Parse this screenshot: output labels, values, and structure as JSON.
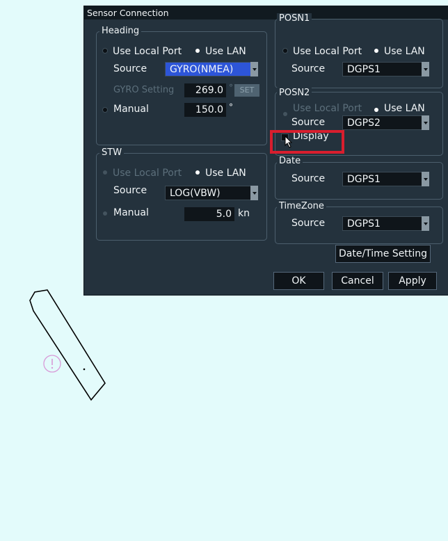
{
  "dialog": {
    "title": "Sensor Connection",
    "heading": {
      "title": "Heading",
      "use_local_port": "Use Local Port",
      "use_lan": "Use LAN",
      "source_label": "Source",
      "source_value": "GYRO(NMEA)",
      "gyro_setting_label": "GYRO Setting",
      "gyro_value": "269.0",
      "gyro_unit": "°",
      "set_label": "SET",
      "manual_label": "Manual",
      "manual_value": "150.0",
      "manual_unit": "°"
    },
    "stw": {
      "title": "STW",
      "use_local_port": "Use Local Port",
      "use_lan": "Use LAN",
      "source_label": "Source",
      "source_value": "LOG(VBW)",
      "manual_label": "Manual",
      "manual_value": "5.0",
      "manual_unit": "kn"
    },
    "posn1": {
      "title": "POSN1",
      "use_local_port": "Use Local Port",
      "use_lan": "Use LAN",
      "source_label": "Source",
      "source_value": "DGPS1"
    },
    "posn2": {
      "title": "POSN2",
      "use_local_port": "Use Local Port",
      "use_lan": "Use LAN",
      "source_label": "Source",
      "source_value": "DGPS2",
      "display_label": "Display"
    },
    "date": {
      "title": "Date",
      "source_label": "Source",
      "source_value": "DGPS1"
    },
    "timezone": {
      "title": "TimeZone",
      "source_label": "Source",
      "source_value": "DGPS1"
    },
    "buttons": {
      "date_time_setting": "Date/Time Setting",
      "ok": "OK",
      "cancel": "Cancel",
      "apply": "Apply"
    }
  },
  "colors": {
    "dialog_bg": "#24323d",
    "screen_bg": "#e3fbfb",
    "highlight": "#d81e2e",
    "selection": "#2d55d8"
  }
}
